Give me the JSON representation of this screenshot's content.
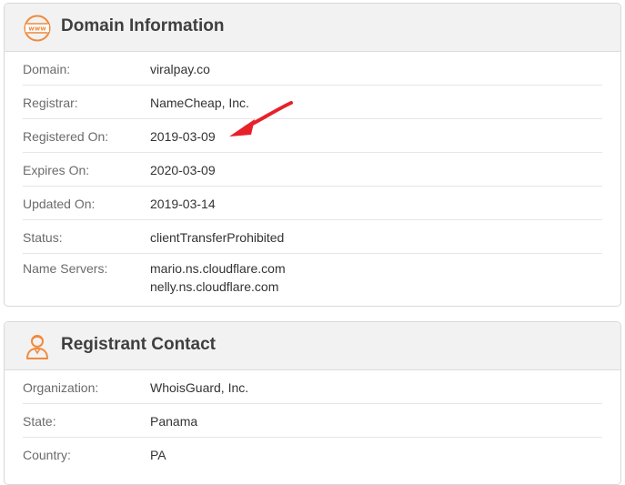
{
  "domain_panel": {
    "title": "Domain Information",
    "icon": "www-globe-icon",
    "icon_color": "#f08a3c",
    "rows": [
      {
        "label": "Domain:",
        "value": "viralpay.co"
      },
      {
        "label": "Registrar:",
        "value": "NameCheap, Inc."
      },
      {
        "label": "Registered On:",
        "value": "2019-03-09"
      },
      {
        "label": "Expires On:",
        "value": "2020-03-09"
      },
      {
        "label": "Updated On:",
        "value": "2019-03-14"
      },
      {
        "label": "Status:",
        "value": "clientTransferProhibited"
      },
      {
        "label": "Name Servers:",
        "values": [
          "mario.ns.cloudflare.com",
          "nelly.ns.cloudflare.com"
        ]
      }
    ]
  },
  "registrant_panel": {
    "title": "Registrant Contact",
    "icon": "person-icon",
    "icon_color": "#f08a3c",
    "rows": [
      {
        "label": "Organization:",
        "value": "WhoisGuard, Inc."
      },
      {
        "label": "State:",
        "value": "Panama"
      },
      {
        "label": "Country:",
        "value": "PA"
      }
    ]
  },
  "annotation": {
    "arrow_color": "#e8202a",
    "points_to": "Registered On"
  }
}
